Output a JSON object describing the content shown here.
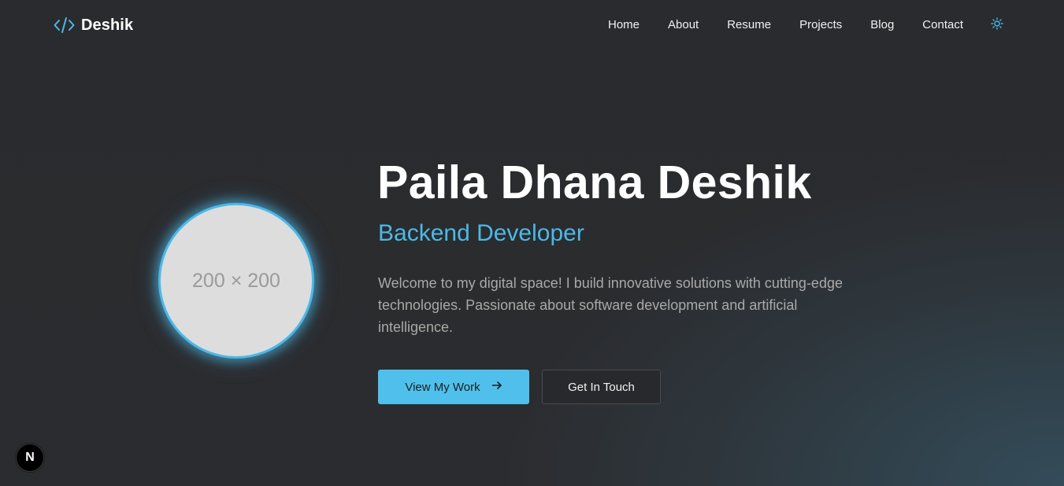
{
  "brand": {
    "name": "Deshik",
    "icon": "code-brackets-icon",
    "accent_color": "#4db8e8"
  },
  "nav": {
    "items": [
      {
        "label": "Home"
      },
      {
        "label": "About"
      },
      {
        "label": "Resume"
      },
      {
        "label": "Projects"
      },
      {
        "label": "Blog"
      },
      {
        "label": "Contact"
      }
    ],
    "theme_toggle_icon": "sun-icon"
  },
  "hero": {
    "avatar_placeholder": "200 × 200",
    "name": "Paila Dhana Deshik",
    "role": "Backend Developer",
    "description": "Welcome to my digital space! I build innovative solutions with cutting-edge technologies. Passionate about software development and artificial intelligence.",
    "primary_button": "View My Work",
    "primary_button_icon": "arrow-right-icon",
    "secondary_button": "Get In Touch"
  },
  "dev_badge": {
    "letter": "N"
  },
  "colors": {
    "background": "#2b2c2f",
    "accent": "#4db8e8",
    "button_primary": "#4fc0eb",
    "muted_text": "#a9a9a9"
  }
}
